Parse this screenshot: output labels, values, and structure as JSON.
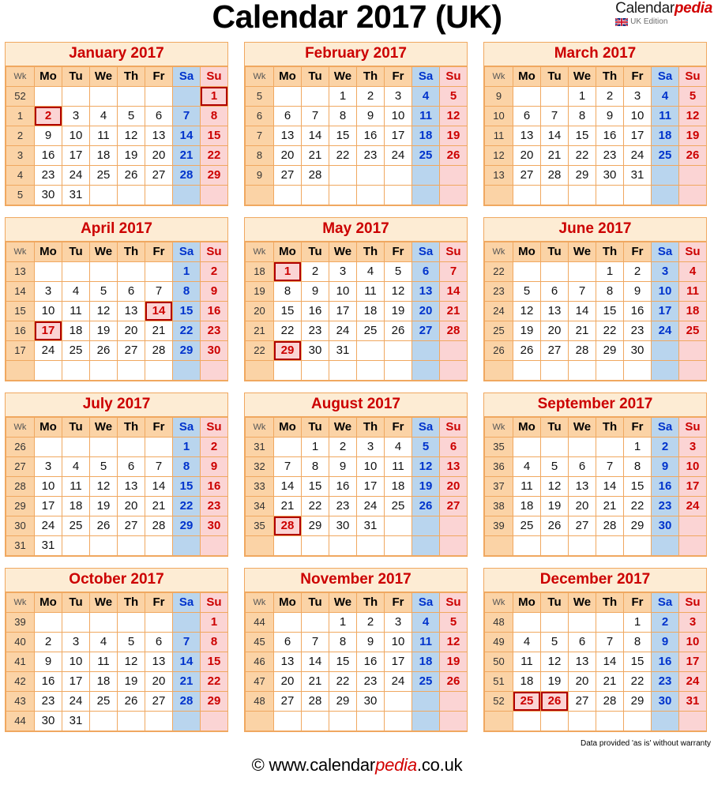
{
  "header": {
    "title": "Calendar 2017 (UK)",
    "brand_main": "Calendar",
    "brand_accent": "pedia",
    "brand_sub": "UK Edition",
    "flag_icon": "uk-flag-icon"
  },
  "colors": {
    "border": "#f0a860",
    "title_bg": "#fdecd4",
    "title_text": "#cc0000",
    "weekday_head_bg": "#fbd3a6",
    "saturday_bg": "#b9d5ee",
    "saturday_text": "#0033cc",
    "sunday_bg": "#fbd4d4",
    "sunday_text": "#cc0000",
    "week_col_bg": "#fbd3a6",
    "holiday_outline": "#b00000"
  },
  "weekday_headers": [
    "Wk",
    "Mo",
    "Tu",
    "We",
    "Th",
    "Fr",
    "Sa",
    "Su"
  ],
  "footer": {
    "copyright_prefix": "© www.calendar",
    "copyright_accent": "pedia",
    "copyright_suffix": ".co.uk",
    "disclaimer": "Data provided 'as is' without warranty"
  },
  "months": [
    {
      "name": "January 2017",
      "weeks": [
        {
          "wk": "52",
          "days": [
            "",
            "",
            "",
            "",
            "",
            "",
            "1"
          ]
        },
        {
          "wk": "1",
          "days": [
            "2",
            "3",
            "4",
            "5",
            "6",
            "7",
            "8"
          ]
        },
        {
          "wk": "2",
          "days": [
            "9",
            "10",
            "11",
            "12",
            "13",
            "14",
            "15"
          ]
        },
        {
          "wk": "3",
          "days": [
            "16",
            "17",
            "18",
            "19",
            "20",
            "21",
            "22"
          ]
        },
        {
          "wk": "4",
          "days": [
            "23",
            "24",
            "25",
            "26",
            "27",
            "28",
            "29"
          ]
        },
        {
          "wk": "5",
          "days": [
            "30",
            "31",
            "",
            "",
            "",
            "",
            ""
          ]
        }
      ],
      "holidays": [
        "1",
        "2"
      ]
    },
    {
      "name": "February 2017",
      "weeks": [
        {
          "wk": "5",
          "days": [
            "",
            "",
            "1",
            "2",
            "3",
            "4",
            "5"
          ]
        },
        {
          "wk": "6",
          "days": [
            "6",
            "7",
            "8",
            "9",
            "10",
            "11",
            "12"
          ]
        },
        {
          "wk": "7",
          "days": [
            "13",
            "14",
            "15",
            "16",
            "17",
            "18",
            "19"
          ]
        },
        {
          "wk": "8",
          "days": [
            "20",
            "21",
            "22",
            "23",
            "24",
            "25",
            "26"
          ]
        },
        {
          "wk": "9",
          "days": [
            "27",
            "28",
            "",
            "",
            "",
            "",
            ""
          ]
        },
        {
          "wk": "",
          "days": [
            "",
            "",
            "",
            "",
            "",
            "",
            ""
          ]
        }
      ],
      "holidays": []
    },
    {
      "name": "March 2017",
      "weeks": [
        {
          "wk": "9",
          "days": [
            "",
            "",
            "1",
            "2",
            "3",
            "4",
            "5"
          ]
        },
        {
          "wk": "10",
          "days": [
            "6",
            "7",
            "8",
            "9",
            "10",
            "11",
            "12"
          ]
        },
        {
          "wk": "11",
          "days": [
            "13",
            "14",
            "15",
            "16",
            "17",
            "18",
            "19"
          ]
        },
        {
          "wk": "12",
          "days": [
            "20",
            "21",
            "22",
            "23",
            "24",
            "25",
            "26"
          ]
        },
        {
          "wk": "13",
          "days": [
            "27",
            "28",
            "29",
            "30",
            "31",
            "",
            ""
          ]
        },
        {
          "wk": "",
          "days": [
            "",
            "",
            "",
            "",
            "",
            "",
            ""
          ]
        }
      ],
      "holidays": []
    },
    {
      "name": "April 2017",
      "weeks": [
        {
          "wk": "13",
          "days": [
            "",
            "",
            "",
            "",
            "",
            "1",
            "2"
          ]
        },
        {
          "wk": "14",
          "days": [
            "3",
            "4",
            "5",
            "6",
            "7",
            "8",
            "9"
          ]
        },
        {
          "wk": "15",
          "days": [
            "10",
            "11",
            "12",
            "13",
            "14",
            "15",
            "16"
          ]
        },
        {
          "wk": "16",
          "days": [
            "17",
            "18",
            "19",
            "20",
            "21",
            "22",
            "23"
          ]
        },
        {
          "wk": "17",
          "days": [
            "24",
            "25",
            "26",
            "27",
            "28",
            "29",
            "30"
          ]
        },
        {
          "wk": "",
          "days": [
            "",
            "",
            "",
            "",
            "",
            "",
            ""
          ]
        }
      ],
      "holidays": [
        "14",
        "17"
      ]
    },
    {
      "name": "May 2017",
      "weeks": [
        {
          "wk": "18",
          "days": [
            "1",
            "2",
            "3",
            "4",
            "5",
            "6",
            "7"
          ]
        },
        {
          "wk": "19",
          "days": [
            "8",
            "9",
            "10",
            "11",
            "12",
            "13",
            "14"
          ]
        },
        {
          "wk": "20",
          "days": [
            "15",
            "16",
            "17",
            "18",
            "19",
            "20",
            "21"
          ]
        },
        {
          "wk": "21",
          "days": [
            "22",
            "23",
            "24",
            "25",
            "26",
            "27",
            "28"
          ]
        },
        {
          "wk": "22",
          "days": [
            "29",
            "30",
            "31",
            "",
            "",
            "",
            ""
          ]
        },
        {
          "wk": "",
          "days": [
            "",
            "",
            "",
            "",
            "",
            "",
            ""
          ]
        }
      ],
      "holidays": [
        "1",
        "29"
      ]
    },
    {
      "name": "June 2017",
      "weeks": [
        {
          "wk": "22",
          "days": [
            "",
            "",
            "",
            "1",
            "2",
            "3",
            "4"
          ]
        },
        {
          "wk": "23",
          "days": [
            "5",
            "6",
            "7",
            "8",
            "9",
            "10",
            "11"
          ]
        },
        {
          "wk": "24",
          "days": [
            "12",
            "13",
            "14",
            "15",
            "16",
            "17",
            "18"
          ]
        },
        {
          "wk": "25",
          "days": [
            "19",
            "20",
            "21",
            "22",
            "23",
            "24",
            "25"
          ]
        },
        {
          "wk": "26",
          "days": [
            "26",
            "27",
            "28",
            "29",
            "30",
            "",
            ""
          ]
        },
        {
          "wk": "",
          "days": [
            "",
            "",
            "",
            "",
            "",
            "",
            ""
          ]
        }
      ],
      "holidays": []
    },
    {
      "name": "July 2017",
      "weeks": [
        {
          "wk": "26",
          "days": [
            "",
            "",
            "",
            "",
            "",
            "1",
            "2"
          ]
        },
        {
          "wk": "27",
          "days": [
            "3",
            "4",
            "5",
            "6",
            "7",
            "8",
            "9"
          ]
        },
        {
          "wk": "28",
          "days": [
            "10",
            "11",
            "12",
            "13",
            "14",
            "15",
            "16"
          ]
        },
        {
          "wk": "29",
          "days": [
            "17",
            "18",
            "19",
            "20",
            "21",
            "22",
            "23"
          ]
        },
        {
          "wk": "30",
          "days": [
            "24",
            "25",
            "26",
            "27",
            "28",
            "29",
            "30"
          ]
        },
        {
          "wk": "31",
          "days": [
            "31",
            "",
            "",
            "",
            "",
            "",
            ""
          ]
        }
      ],
      "holidays": []
    },
    {
      "name": "August 2017",
      "weeks": [
        {
          "wk": "31",
          "days": [
            "",
            "1",
            "2",
            "3",
            "4",
            "5",
            "6"
          ]
        },
        {
          "wk": "32",
          "days": [
            "7",
            "8",
            "9",
            "10",
            "11",
            "12",
            "13"
          ]
        },
        {
          "wk": "33",
          "days": [
            "14",
            "15",
            "16",
            "17",
            "18",
            "19",
            "20"
          ]
        },
        {
          "wk": "34",
          "days": [
            "21",
            "22",
            "23",
            "24",
            "25",
            "26",
            "27"
          ]
        },
        {
          "wk": "35",
          "days": [
            "28",
            "29",
            "30",
            "31",
            "",
            "",
            ""
          ]
        },
        {
          "wk": "",
          "days": [
            "",
            "",
            "",
            "",
            "",
            "",
            ""
          ]
        }
      ],
      "holidays": [
        "28"
      ]
    },
    {
      "name": "September 2017",
      "weeks": [
        {
          "wk": "35",
          "days": [
            "",
            "",
            "",
            "",
            "1",
            "2",
            "3"
          ]
        },
        {
          "wk": "36",
          "days": [
            "4",
            "5",
            "6",
            "7",
            "8",
            "9",
            "10"
          ]
        },
        {
          "wk": "37",
          "days": [
            "11",
            "12",
            "13",
            "14",
            "15",
            "16",
            "17"
          ]
        },
        {
          "wk": "38",
          "days": [
            "18",
            "19",
            "20",
            "21",
            "22",
            "23",
            "24"
          ]
        },
        {
          "wk": "39",
          "days": [
            "25",
            "26",
            "27",
            "28",
            "29",
            "30",
            ""
          ]
        },
        {
          "wk": "",
          "days": [
            "",
            "",
            "",
            "",
            "",
            "",
            ""
          ]
        }
      ],
      "holidays": []
    },
    {
      "name": "October 2017",
      "weeks": [
        {
          "wk": "39",
          "days": [
            "",
            "",
            "",
            "",
            "",
            "",
            "1"
          ]
        },
        {
          "wk": "40",
          "days": [
            "2",
            "3",
            "4",
            "5",
            "6",
            "7",
            "8"
          ]
        },
        {
          "wk": "41",
          "days": [
            "9",
            "10",
            "11",
            "12",
            "13",
            "14",
            "15"
          ]
        },
        {
          "wk": "42",
          "days": [
            "16",
            "17",
            "18",
            "19",
            "20",
            "21",
            "22"
          ]
        },
        {
          "wk": "43",
          "days": [
            "23",
            "24",
            "25",
            "26",
            "27",
            "28",
            "29"
          ]
        },
        {
          "wk": "44",
          "days": [
            "30",
            "31",
            "",
            "",
            "",
            "",
            ""
          ]
        }
      ],
      "holidays": []
    },
    {
      "name": "November 2017",
      "weeks": [
        {
          "wk": "44",
          "days": [
            "",
            "",
            "1",
            "2",
            "3",
            "4",
            "5"
          ]
        },
        {
          "wk": "45",
          "days": [
            "6",
            "7",
            "8",
            "9",
            "10",
            "11",
            "12"
          ]
        },
        {
          "wk": "46",
          "days": [
            "13",
            "14",
            "15",
            "16",
            "17",
            "18",
            "19"
          ]
        },
        {
          "wk": "47",
          "days": [
            "20",
            "21",
            "22",
            "23",
            "24",
            "25",
            "26"
          ]
        },
        {
          "wk": "48",
          "days": [
            "27",
            "28",
            "29",
            "30",
            "",
            "",
            ""
          ]
        },
        {
          "wk": "",
          "days": [
            "",
            "",
            "",
            "",
            "",
            "",
            ""
          ]
        }
      ],
      "holidays": []
    },
    {
      "name": "December 2017",
      "weeks": [
        {
          "wk": "48",
          "days": [
            "",
            "",
            "",
            "",
            "1",
            "2",
            "3"
          ]
        },
        {
          "wk": "49",
          "days": [
            "4",
            "5",
            "6",
            "7",
            "8",
            "9",
            "10"
          ]
        },
        {
          "wk": "50",
          "days": [
            "11",
            "12",
            "13",
            "14",
            "15",
            "16",
            "17"
          ]
        },
        {
          "wk": "51",
          "days": [
            "18",
            "19",
            "20",
            "21",
            "22",
            "23",
            "24"
          ]
        },
        {
          "wk": "52",
          "days": [
            "25",
            "26",
            "27",
            "28",
            "29",
            "30",
            "31"
          ]
        },
        {
          "wk": "",
          "days": [
            "",
            "",
            "",
            "",
            "",
            "",
            ""
          ]
        }
      ],
      "holidays": [
        "25",
        "26"
      ]
    }
  ]
}
